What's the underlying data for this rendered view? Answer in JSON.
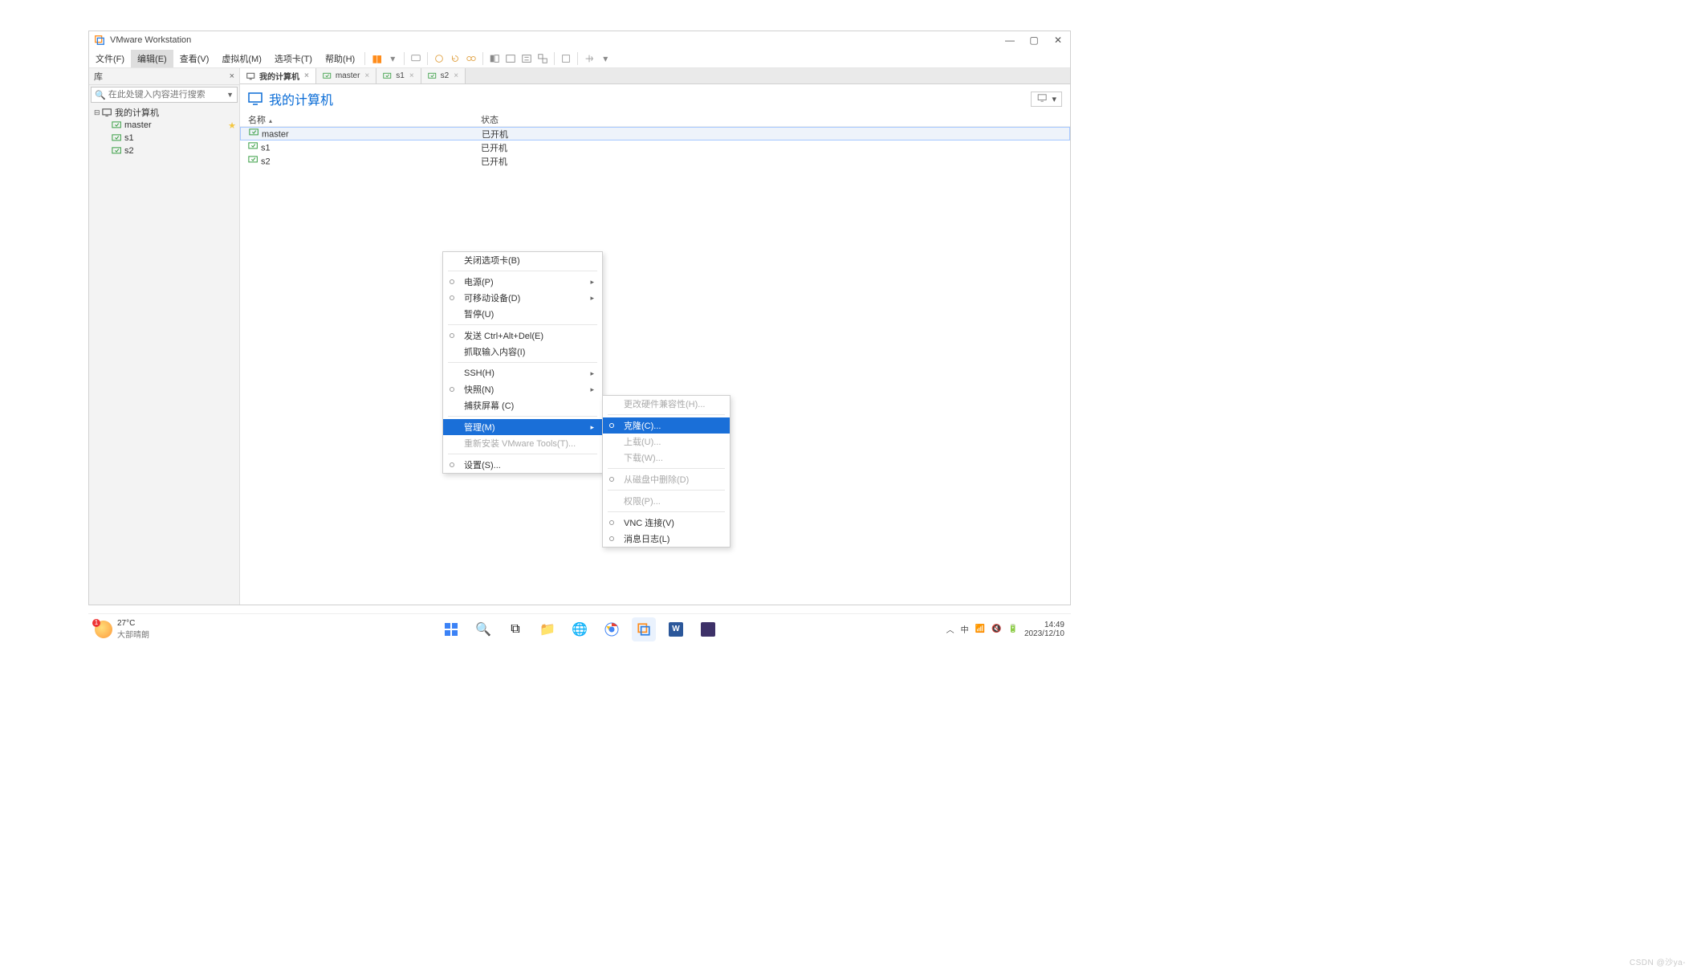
{
  "app": {
    "title": "VMware Workstation"
  },
  "window_buttons": {
    "min": "—",
    "max": "▢",
    "close": "✕"
  },
  "menubar": {
    "file": "文件(F)",
    "edit": "编辑(E)",
    "view": "查看(V)",
    "vm": "虚拟机(M)",
    "tabs": "选项卡(T)",
    "help": "帮助(H)"
  },
  "library": {
    "title": "库",
    "close": "×",
    "search_placeholder": "在此处键入内容进行搜索",
    "root": "我的计算机",
    "items": [
      "master",
      "s1",
      "s2"
    ]
  },
  "tabs": [
    {
      "label": "我的计算机",
      "kind": "home",
      "closable": true,
      "active": true
    },
    {
      "label": "master",
      "kind": "vm",
      "closable": true
    },
    {
      "label": "s1",
      "kind": "vm",
      "closable": true
    },
    {
      "label": "s2",
      "kind": "vm",
      "closable": true
    }
  ],
  "page": {
    "title": "我的计算机",
    "columns": {
      "name": "名称",
      "status": "状态"
    },
    "rows": [
      {
        "name": "master",
        "status": "已开机",
        "selected": true
      },
      {
        "name": "s1",
        "status": "已开机"
      },
      {
        "name": "s2",
        "status": "已开机"
      }
    ]
  },
  "context_menu_1": {
    "close_tab": "关闭选项卡(B)",
    "power": "电源(P)",
    "removable": "可移动设备(D)",
    "pause": "暂停(U)",
    "send_cad": "发送 Ctrl+Alt+Del(E)",
    "grab_input": "抓取输入内容(I)",
    "ssh": "SSH(H)",
    "snapshot": "快照(N)",
    "capture": "捕获屏幕 (C)",
    "manage": "管理(M)",
    "reinstall_tools": "重新安装 VMware Tools(T)...",
    "settings": "设置(S)..."
  },
  "context_menu_2": {
    "change_hw": "更改硬件兼容性(H)...",
    "clone": "克隆(C)...",
    "upload": "上载(U)...",
    "download": "下载(W)...",
    "delete_disk": "从磁盘中删除(D)",
    "permissions": "权限(P)...",
    "vnc": "VNC 连接(V)",
    "message_log": "消息日志(L)"
  },
  "taskbar": {
    "weather": {
      "temp": "27°C",
      "desc": "大部晴朗",
      "badge": "1"
    },
    "tray": {
      "ime": "中",
      "time": "14:49",
      "date": "2023/12/10"
    }
  },
  "watermark": "CSDN @沙ya-"
}
